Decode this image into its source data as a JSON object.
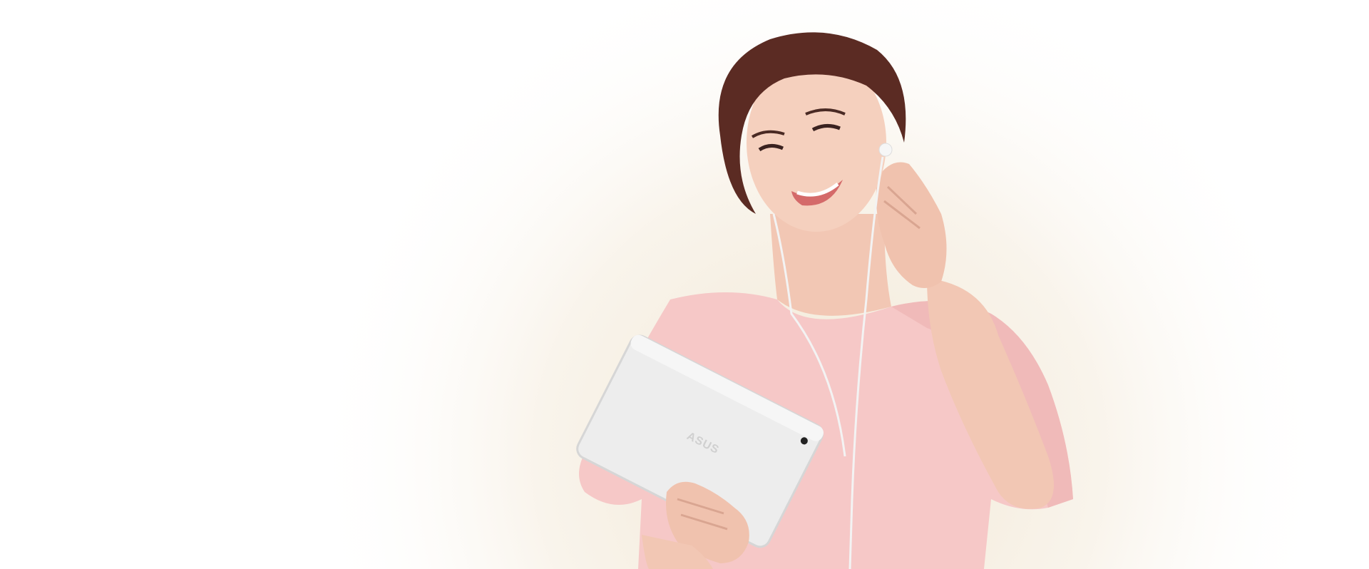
{
  "scene": {
    "description_free": true,
    "colors": {
      "background": "#ffffff",
      "glow": "#f3ead9",
      "top": "#f6c9c9",
      "skin": "#f4cdbb",
      "skin_shadow": "#e3ad98",
      "hair": "#5a2a22",
      "tablet": "#eeeeee",
      "tablet_edge": "#d8d8d8",
      "earphone": "#f4f4f4",
      "lips": "#d46a6a"
    },
    "tablet_logo": "ASUS"
  }
}
